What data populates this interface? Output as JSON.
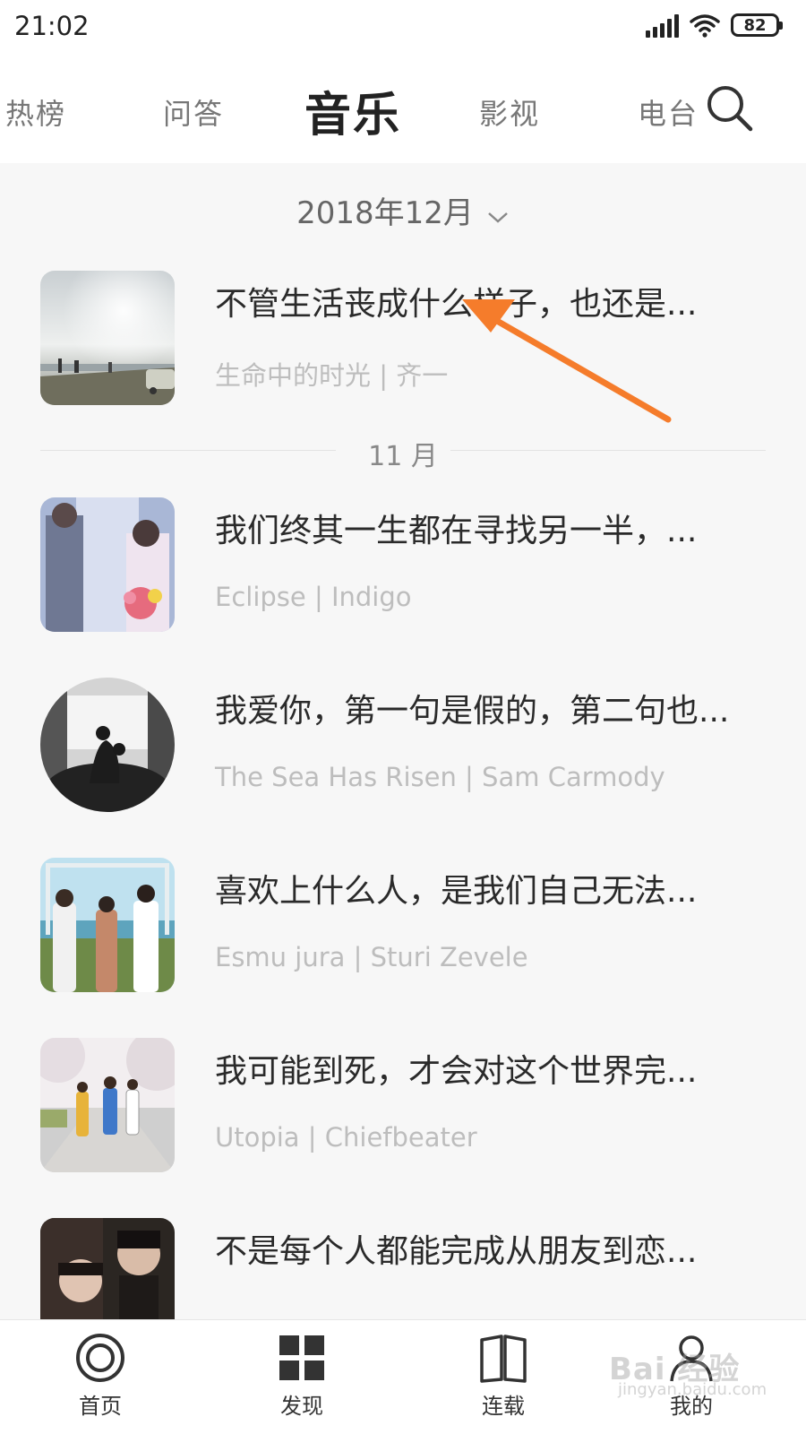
{
  "status": {
    "time": "21:02",
    "battery": "82"
  },
  "top_nav": {
    "tabs": [
      {
        "label": "热榜"
      },
      {
        "label": "问答"
      },
      {
        "label": "音乐",
        "active": true
      },
      {
        "label": "影视"
      },
      {
        "label": "电台"
      }
    ],
    "search_icon": "search-icon"
  },
  "content": {
    "month_picker": "2018年12月",
    "divider_label": "11 月",
    "items": [
      {
        "title": "不管生活丧成什么样子，也还是...",
        "subtitle": "生命中的时光 | 齐一"
      },
      {
        "title": "我们终其一生都在寻找另一半，...",
        "subtitle": "Eclipse | Indigo"
      },
      {
        "title": "我爱你，第一句是假的，第二句也...",
        "subtitle": "The Sea Has Risen | Sam Carmody"
      },
      {
        "title": "喜欢上什么人，是我们自己无法...",
        "subtitle": "Esmu jura | Sturi Zevele"
      },
      {
        "title": "我可能到死，才会对这个世界完...",
        "subtitle": "Utopia | Chiefbeater"
      },
      {
        "title": "不是每个人都能完成从朋友到恋...",
        "subtitle": ""
      }
    ]
  },
  "bottom_nav": {
    "items": [
      {
        "label": "首页",
        "icon": "home-ring-icon"
      },
      {
        "label": "发现",
        "icon": "grid-icon"
      },
      {
        "label": "连载",
        "icon": "book-icon"
      },
      {
        "label": "我的",
        "icon": "person-icon"
      }
    ]
  },
  "watermark": {
    "text": "Bai 经验",
    "sub": "jingyan.baidu.com"
  },
  "colors": {
    "annotation_arrow": "#f57c2b",
    "title_text": "#2a2a2a",
    "subtitle_text": "#bdbdbd",
    "background": "#f7f7f7"
  }
}
